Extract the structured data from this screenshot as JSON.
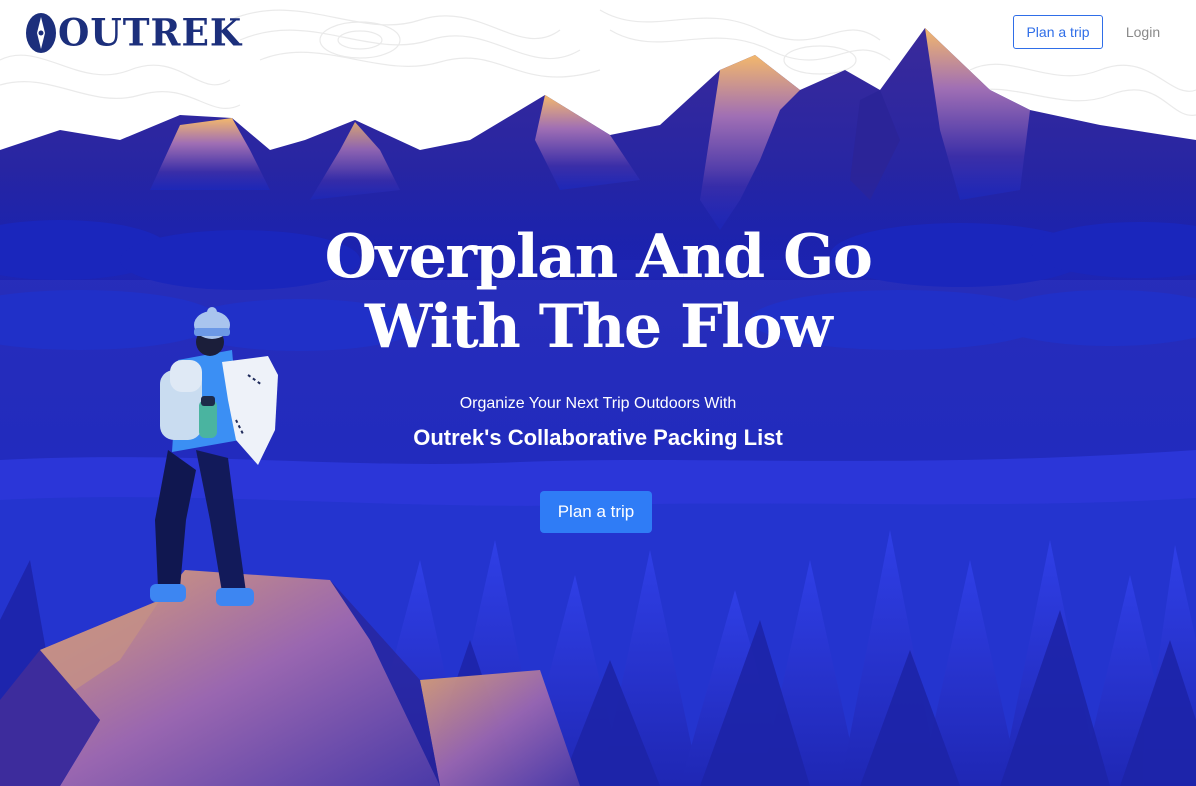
{
  "nav": {
    "logo_text": "OUTREK",
    "plan_trip_label": "Plan a trip",
    "login_label": "Login"
  },
  "hero": {
    "title_line1": "Overplan And Go",
    "title_line2": "With The Flow",
    "subtitle": "Organize Your Next Trip Outdoors With",
    "subtitle_strong": "Outrek's Collaborative Packing List",
    "cta_label": "Plan a trip"
  },
  "colors": {
    "brand_navy": "#1c2f7c",
    "accent_blue": "#2f7cf6",
    "outline_blue": "#2f6ee8",
    "sky_deep": "#1a24b0",
    "peak_glow": "#f2b36a",
    "peak_violet": "#8a5fb5"
  },
  "icons": {
    "logo_mark": "compass-needle-icon"
  }
}
